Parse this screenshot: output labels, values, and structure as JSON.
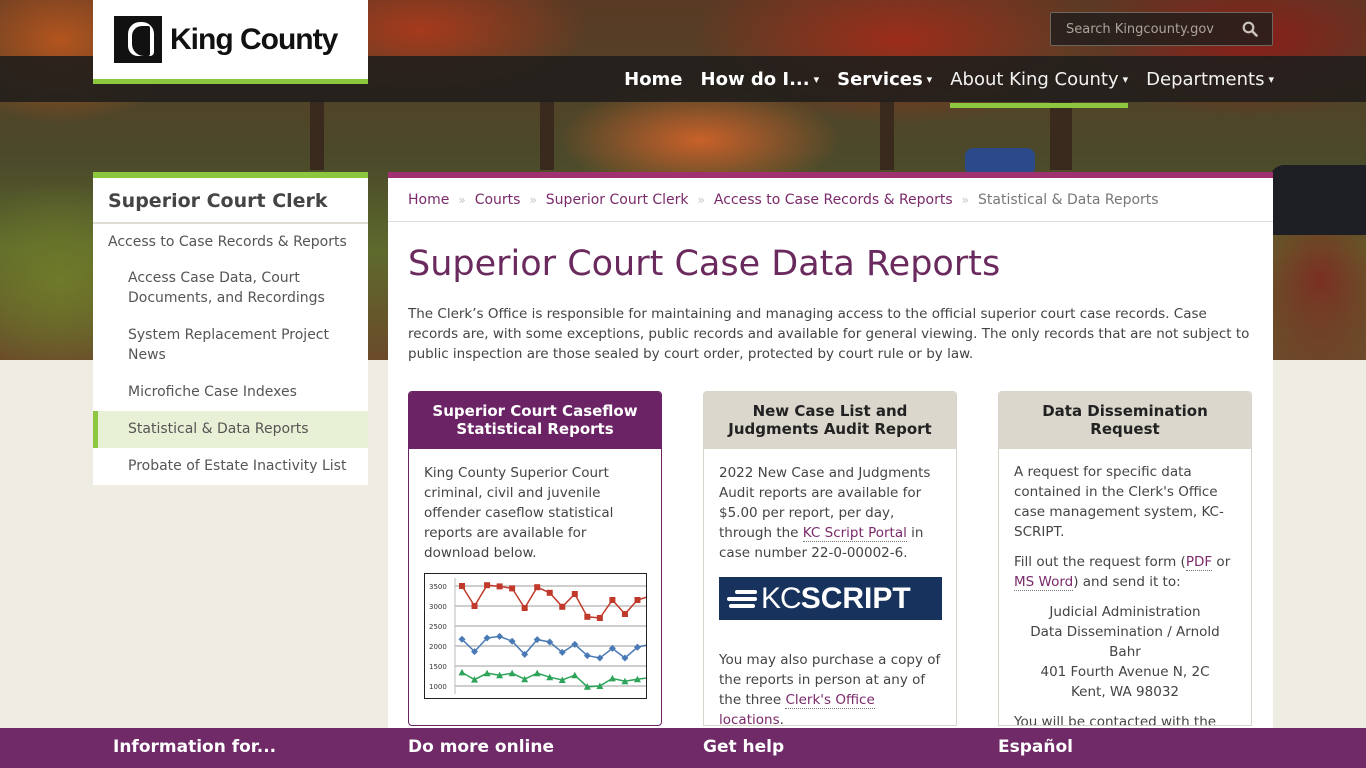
{
  "header": {
    "logo_text": "King County",
    "search_placeholder": "Search Kingcounty.gov",
    "nav": [
      {
        "label": "Home",
        "has_dropdown": false
      },
      {
        "label": "How do I...",
        "has_dropdown": true
      },
      {
        "label": "Services",
        "has_dropdown": true
      },
      {
        "label": "About King County",
        "has_dropdown": true,
        "active": true
      },
      {
        "label": "Departments",
        "has_dropdown": true
      }
    ],
    "caret": "▾"
  },
  "sidebar": {
    "title": "Superior Court Clerk",
    "parent": "Access to Case Records & Reports",
    "items": [
      {
        "label": "Access Case Data, Court Documents, and Recordings"
      },
      {
        "label": "System Replacement Project News"
      },
      {
        "label": "Microfiche Case Indexes"
      },
      {
        "label": "Statistical & Data Reports",
        "active": true
      },
      {
        "label": "Probate of Estate Inactivity List"
      }
    ]
  },
  "breadcrumb": {
    "separator": "»",
    "items": [
      "Home",
      "Courts",
      "Superior Court Clerk",
      "Access to Case Records & Reports",
      "Statistical & Data Reports"
    ]
  },
  "main": {
    "title": "Superior Court Case Data Reports",
    "intro": "The Clerk’s Office is responsible for maintaining and managing access to the official superior court case records. Case records are, with some exceptions, public records and available for general viewing. The only records that are not subject to public inspection are those sealed by court order, protected by court rule or by law."
  },
  "cards": [
    {
      "title": "Superior Court Caseflow Statistical Reports",
      "body": "King County Superior Court criminal, civil and juvenile offender caseflow statistical reports are available for download below."
    },
    {
      "title": "New Case List and Judgments Audit Report",
      "body_pre": "2022 New Case and Judgments Audit reports are available for $5.00 per report, per day, through the ",
      "link1": "KC Script Portal",
      "body_post": " in case number 22-0-00002-6.",
      "logo_kc": "KC",
      "logo_script": "SCRIPT",
      "body2_pre": "You may also purchase a copy of the reports in person at any of the three ",
      "link2": "Clerk's Office locations",
      "body2_post": "."
    },
    {
      "title": "Data Dissemination Request",
      "p1": "A request for specific data contained in the Clerk's Office case management system, KC-SCRIPT.",
      "p2_pre": "Fill out the request form (",
      "link_pdf": "PDF",
      "p2_mid": " or ",
      "link_word": "MS Word",
      "p2_post": ") and send it to:",
      "address": [
        "Judicial Administration",
        "Data Dissemination / Arnold Bahr",
        "401 Fourth Avenue N, 2C",
        "Kent, WA 98032"
      ],
      "p3": "You will be contacted with the feasibility of the request and"
    }
  ],
  "chart_data": {
    "type": "line",
    "title": "",
    "xlabel": "",
    "ylabel": "",
    "ylim": [
      800,
      3700
    ],
    "yticks": [
      1000,
      1500,
      2000,
      2500,
      3000,
      3500
    ],
    "grid": true,
    "series": [
      {
        "name": "red",
        "color": "#c0392b",
        "marker": "square",
        "values": [
          3500,
          3000,
          3520,
          3490,
          3440,
          2950,
          3470,
          3330,
          2980,
          3300,
          2730,
          2700,
          3150,
          2800,
          3150,
          3250
        ]
      },
      {
        "name": "blue",
        "color": "#4a7ab5",
        "marker": "diamond",
        "values": [
          2170,
          1860,
          2200,
          2240,
          2120,
          1790,
          2160,
          2100,
          1840,
          2040,
          1760,
          1700,
          1940,
          1700,
          1970,
          2040
        ]
      },
      {
        "name": "green",
        "color": "#2ea35a",
        "marker": "triangle",
        "values": [
          1340,
          1160,
          1320,
          1270,
          1320,
          1170,
          1320,
          1220,
          1150,
          1270,
          980,
          1000,
          1190,
          1120,
          1170,
          1210
        ]
      }
    ]
  },
  "footer": {
    "items": [
      "Information for...",
      "Do more online",
      "Get help",
      "Español"
    ]
  }
}
